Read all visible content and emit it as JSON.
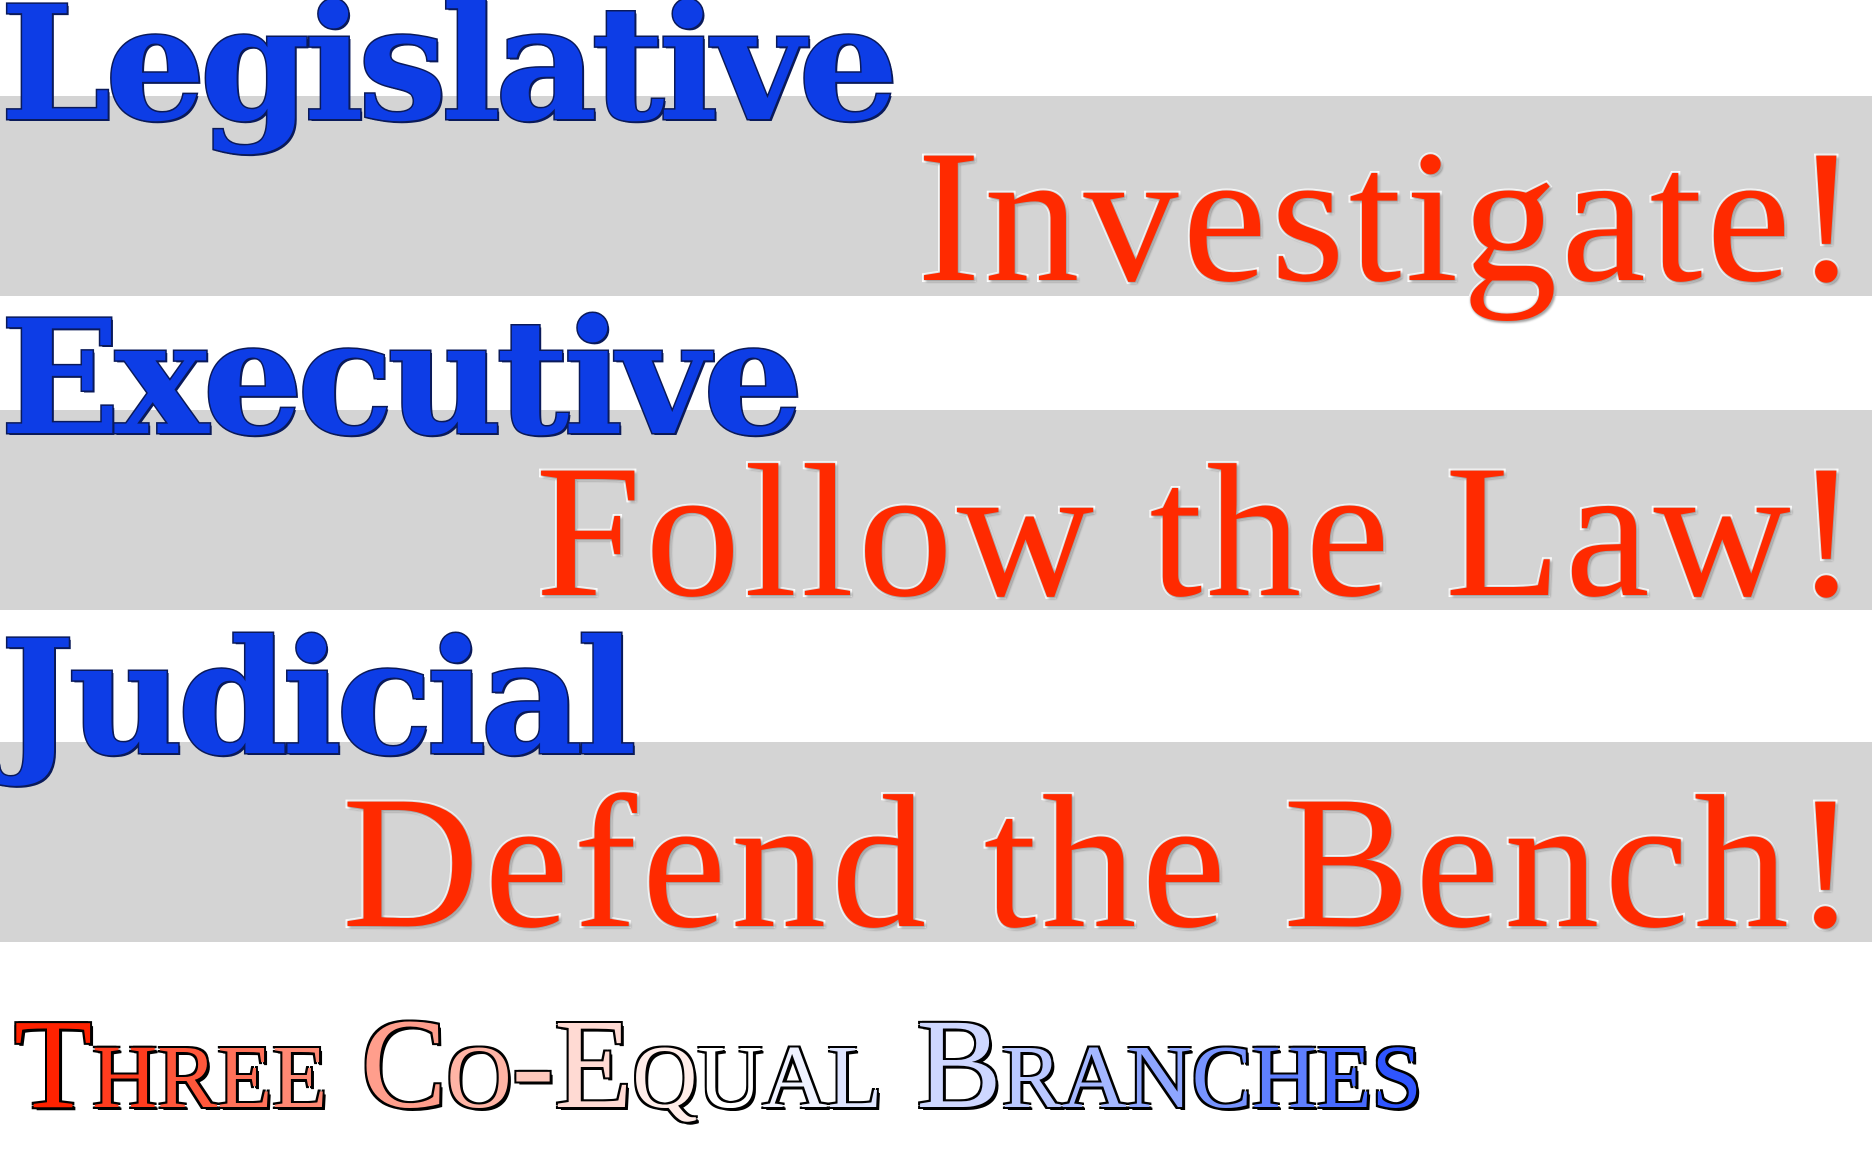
{
  "rows": [
    {
      "branch": "Legislative",
      "slogan": "Investigate!"
    },
    {
      "branch": "Executive",
      "slogan": "Follow the Law!"
    },
    {
      "branch": "Judicial",
      "slogan": "Defend the Bench!"
    }
  ],
  "tagline": {
    "words": [
      "Three",
      "Co-Equal",
      "Branches"
    ]
  },
  "colors": {
    "branch_text": "#0d3de6",
    "slogan_text": "#ff2a00",
    "band": "#d4d4d4",
    "tagline_gradient": [
      "#ff2200",
      "#ff7a63",
      "#ffc2b5",
      "#ffffff",
      "#c9d3ff",
      "#7f9bff",
      "#2f55ff"
    ]
  }
}
